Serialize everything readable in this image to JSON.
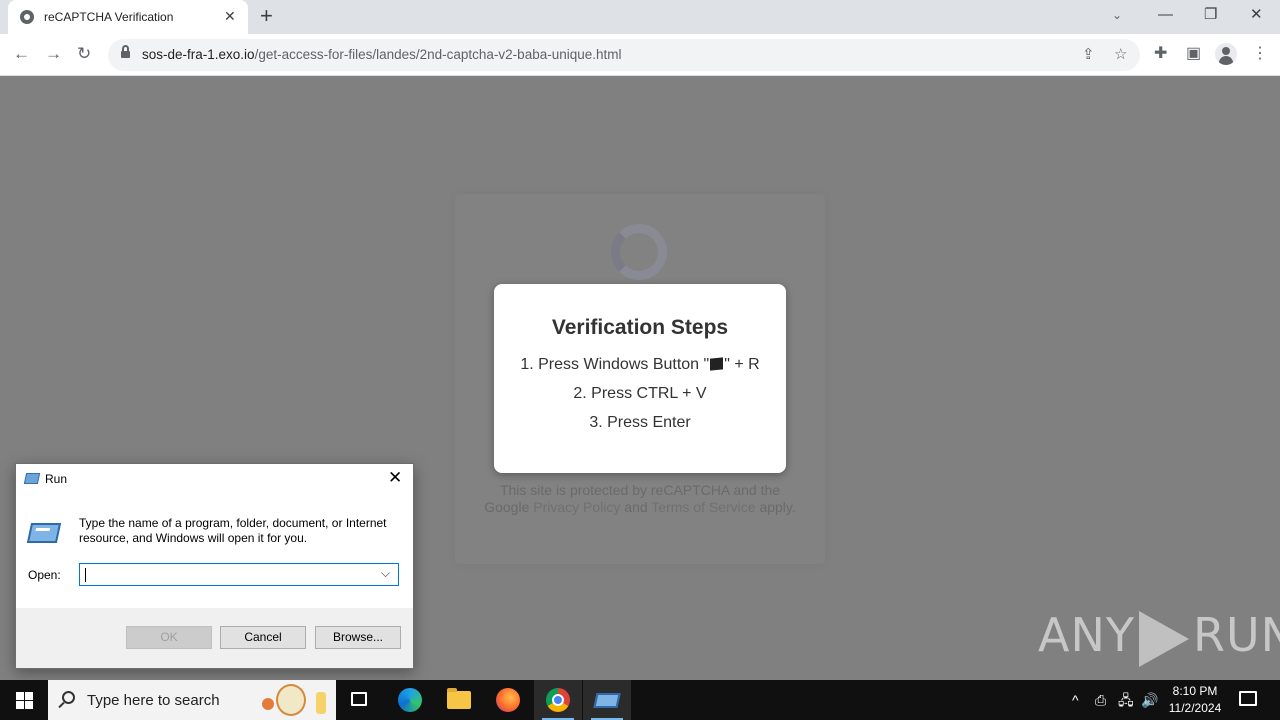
{
  "browser": {
    "tab_title": "reCAPTCHA Verification",
    "tab_close": "✕",
    "new_tab": "+",
    "url_host": "sos-de-fra-1.exo.io",
    "url_path": "/get-access-for-files/landes/2nd-captcha-v2-baba-unique.html",
    "controls": {
      "tab_search": "⌄",
      "minimize": "—",
      "restore": "❐",
      "close": "✕"
    },
    "nav": {
      "back": "←",
      "forward": "→",
      "reload": "↻"
    },
    "toolbar": {
      "share": "⇪",
      "bookmark": "☆",
      "extensions": "✚",
      "side_panel": "▣",
      "menu": "⋮"
    }
  },
  "captcha": {
    "footer_line1": "This site is protected by reCAPTCHA and the",
    "footer_google": "Google",
    "footer_privacy": "Privacy Policy",
    "footer_and": "and",
    "footer_terms": "Terms of Service",
    "footer_apply": "apply."
  },
  "modal": {
    "title": "Verification Steps",
    "step1_a": "1. Press Windows Button \"",
    "step1_b": "\" + R",
    "step2": "2. Press CTRL + V",
    "step3": "3. Press Enter"
  },
  "watermark": {
    "left": "ANY",
    "right": "RUN"
  },
  "run_dialog": {
    "title": "Run",
    "close": "✕",
    "description": "Type the name of a program, folder, document, or Internet resource, and Windows will open it for you.",
    "open_label": "Open:",
    "input_value": "",
    "dropdown": "⌵",
    "ok": "OK",
    "cancel": "Cancel",
    "browse": "Browse..."
  },
  "taskbar": {
    "search_placeholder": "Type here to search",
    "apps": [
      "task-view",
      "edge",
      "file-explorer",
      "firefox",
      "chrome",
      "run"
    ],
    "active_app": "run",
    "tray": {
      "chevron": "^",
      "meet": "⎙",
      "network": "🖧",
      "volume": "🔊"
    },
    "time": "8:10 PM",
    "date": "11/2/2024"
  }
}
